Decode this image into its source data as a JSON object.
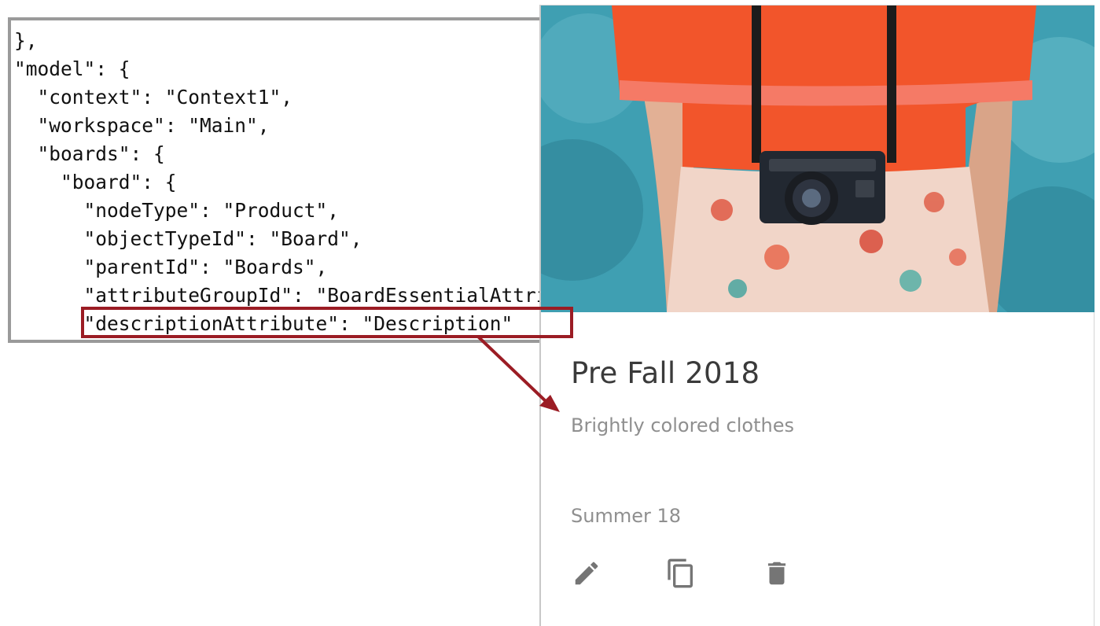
{
  "code": {
    "lines": [
      "},",
      "\"model\": {",
      "  \"context\": \"Context1\",",
      "  \"workspace\": \"Main\",",
      "  \"boards\": {",
      "    \"board\": {",
      "      \"nodeType\": \"Product\",",
      "      \"objectTypeId\": \"Board\",",
      "      \"parentId\": \"Boards\",",
      "      \"attributeGroupId\": \"BoardEssentialAttributes\",",
      "      \"descriptionAttribute\": \"Description\""
    ],
    "highlight_color": "#9b1c24"
  },
  "board_card": {
    "title": "Pre Fall 2018",
    "description": "Brightly colored clothes",
    "season": "Summer 18",
    "actions": [
      {
        "name": "edit",
        "icon": "pencil-icon"
      },
      {
        "name": "copy",
        "icon": "copy-icon"
      },
      {
        "name": "delete",
        "icon": "trash-icon"
      }
    ]
  },
  "colors": {
    "title": "#3a3a3a",
    "muted_text": "#8f8f8f",
    "icon": "#757575",
    "shirt": "#f2552b",
    "sky": "#3f9fb2"
  }
}
